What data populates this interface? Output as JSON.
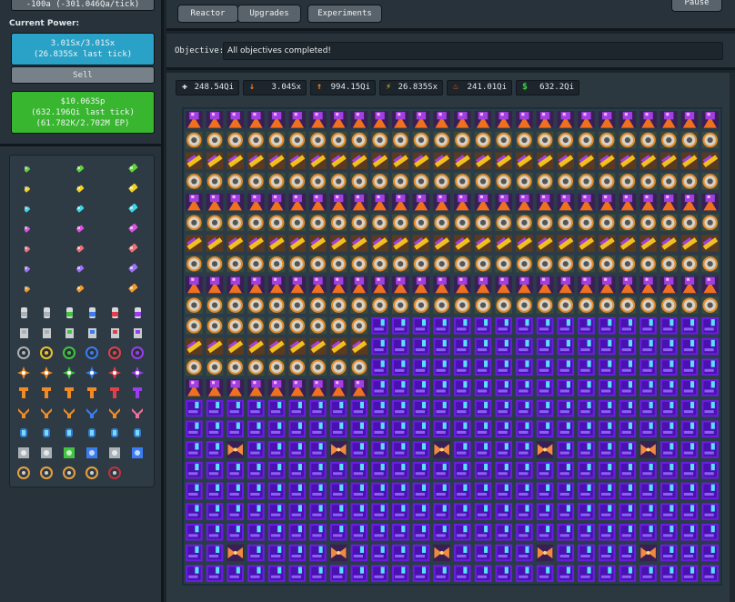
{
  "status": {
    "heat_display": "-100a (-301.046Qa/tick)",
    "power_label": "Current Power:",
    "power_line1": "3.01Sx/3.01Sx",
    "power_line2": "(26.835Sx last tick)",
    "sell_label": "Sell",
    "money_line1": "$10.063Sp",
    "money_line2": "(632.196Qi last tick)",
    "money_line3": "(61.782K/2.702M EP)"
  },
  "nav": {
    "tabs": [
      "Reactor",
      "Upgrades",
      "Experiments"
    ],
    "pause_label": "Pause"
  },
  "objective": {
    "label": "Objective:",
    "text": "All objectives completed!"
  },
  "stats": [
    {
      "icon": "vent-icon",
      "value": "248.54Qi",
      "color": "#c9d4da"
    },
    {
      "icon": "heat-down-icon",
      "value": "3.04Sx",
      "color": "#ff7a1a"
    },
    {
      "icon": "heat-up-icon",
      "value": "994.15Qi",
      "color": "#ff8a1a"
    },
    {
      "icon": "power-bolt-icon",
      "value": "26.835Sx",
      "color": "#f4d21c"
    },
    {
      "icon": "flame-icon",
      "value": "241.01Qi",
      "color": "#ff5a1a"
    },
    {
      "icon": "money-icon",
      "value": "632.2Qi",
      "color": "#3bd23b"
    }
  ],
  "parts_palette": {
    "rows": [
      [
        "cell-green",
        "cell-green-double",
        "cell-green-quad"
      ],
      [
        "cell-yellow",
        "cell-yellow-double",
        "cell-yellow-quad"
      ],
      [
        "cell-cyan",
        "cell-cyan-double",
        "cell-cyan-quad"
      ],
      [
        "cell-magenta",
        "cell-magenta-double",
        "cell-magenta-quad"
      ],
      [
        "cell-red",
        "cell-red-double",
        "cell-red-quad"
      ],
      [
        "cell-violet",
        "cell-violet-double",
        "cell-violet-quad"
      ],
      [
        "cell-orange",
        "cell-orange-double",
        "cell-orange-quad"
      ]
    ],
    "components": [
      [
        "capacitor-gray",
        "capacitor-gray",
        "capacitor-green",
        "capacitor-blue",
        "capacitor-red",
        "capacitor-purple"
      ],
      [
        "plating-gray",
        "plating-gray",
        "plating-green",
        "plating-blue",
        "plating-red",
        "plating-purple"
      ],
      [
        "reflector-gray",
        "reflector-yellow",
        "reflector-green",
        "reflector-blue",
        "reflector-red",
        "reflector-purple"
      ],
      [
        "exchanger-orange",
        "exchanger-orange",
        "exchanger-green",
        "exchanger-blue",
        "exchanger-red",
        "exchanger-purple"
      ],
      [
        "inlet-orange",
        "inlet-orange",
        "inlet-orange",
        "inlet-orange",
        "inlet-red",
        "inlet-purple"
      ],
      [
        "outlet-orange",
        "outlet-orange",
        "outlet-orange",
        "outlet-blue",
        "outlet-orange",
        "outlet-pink"
      ],
      [
        "coolant-blue",
        "coolant-blue",
        "coolant-blue",
        "coolant-blue",
        "coolant-blue",
        "coolant-blue"
      ],
      [
        "vent-gray",
        "vent-gray",
        "vent-green",
        "vent-blue",
        "vent-gray",
        "vent-blue"
      ],
      [
        "particle-accel",
        "particle-accel",
        "particle-accel",
        "particle-accel",
        "particle-accel-red"
      ]
    ]
  },
  "reactor_grid": {
    "cols": 26,
    "rows": 23,
    "row_patterns": [
      "A",
      "B",
      "C",
      "B",
      "A",
      "B",
      "C",
      "B",
      "A",
      "B",
      "MIX_B",
      "MIX_C",
      "MIX_B",
      "MIX_A",
      "P",
      "P",
      "Q",
      "P",
      "P",
      "P",
      "P",
      "Q",
      "P"
    ]
  },
  "colors": {
    "accent_power": "#2aa2c7",
    "accent_money": "#39b630",
    "grid_bg": "#23445a"
  }
}
